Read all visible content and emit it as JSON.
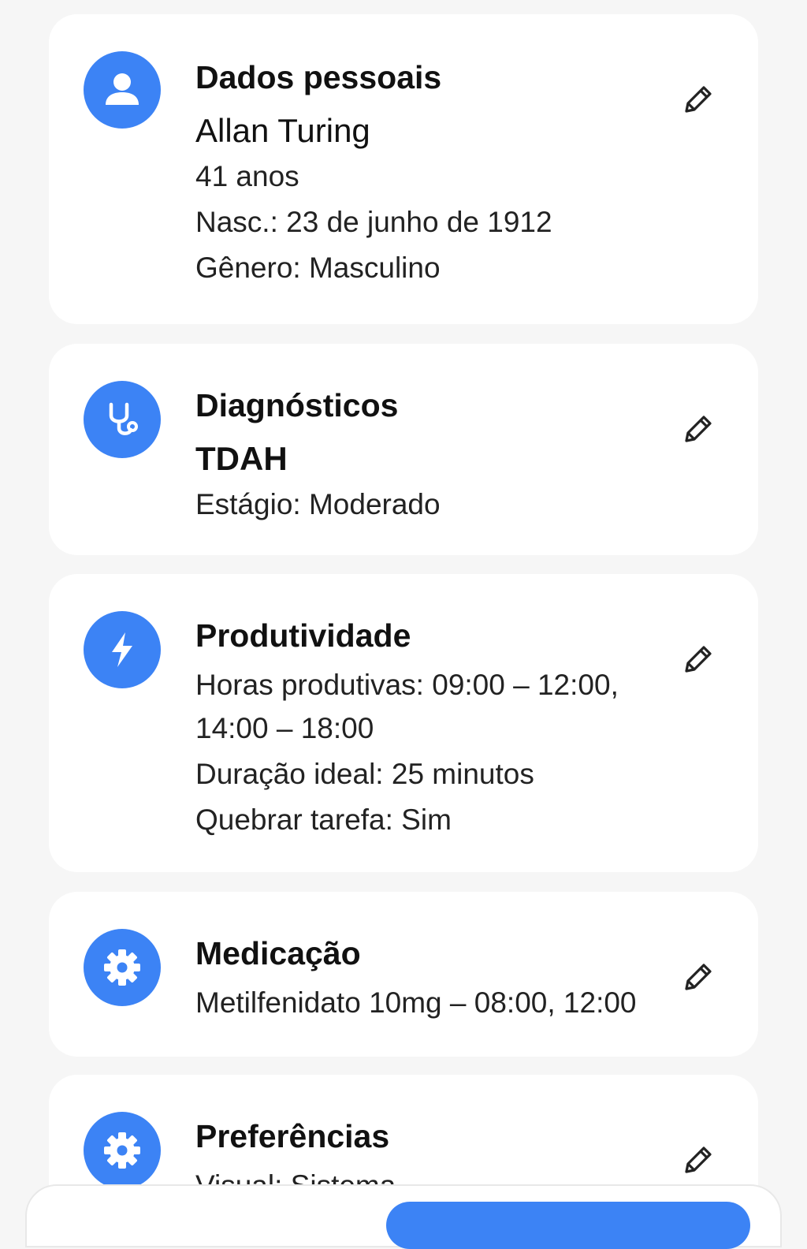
{
  "colors": {
    "accent": "#3c83f5",
    "background": "#f6f6f6",
    "card": "#ffffff",
    "text": "#111111"
  },
  "cards": [
    {
      "icon": "person-icon",
      "title": "Dados pessoais",
      "main": "Allan Turing",
      "lines": [
        "41 anos",
        "Nasc.:  23 de junho de 1912",
        "Gênero: Masculino"
      ]
    },
    {
      "icon": "stethoscope-icon",
      "title": "Diagnósticos",
      "main": "TDAH",
      "lines": [
        "Estágio: Moderado"
      ]
    },
    {
      "icon": "lightning-icon",
      "title": "Produtividade",
      "lines": [
        "Horas produtivas:  09:00 – 12:00,",
        "14:00 – 18:00",
        "Duração ideal: 25 minutos",
        "Quebrar tarefa: Sim"
      ]
    },
    {
      "icon": "gear-icon",
      "title": "Medicação",
      "lines": [
        "Metilfenidato  10mg – 08:00, 12:00"
      ]
    },
    {
      "icon": "gear-icon",
      "title": "Preferências",
      "lines": [
        "Visual: Sistema"
      ]
    }
  ]
}
